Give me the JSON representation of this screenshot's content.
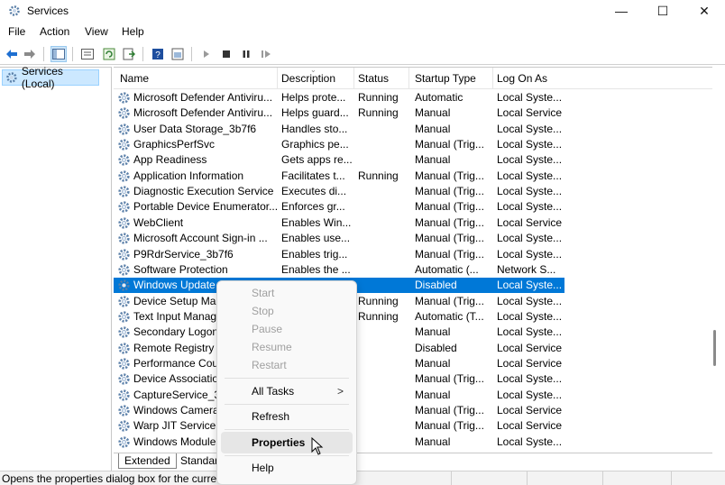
{
  "window": {
    "title": "Services",
    "min": "—",
    "max": "☐",
    "close": "✕"
  },
  "menu": [
    "File",
    "Action",
    "View",
    "Help"
  ],
  "tree": {
    "root": "Services (Local)"
  },
  "columns": {
    "name": "Name",
    "description": "Description",
    "status": "Status",
    "startup": "Startup Type",
    "logon": "Log On As"
  },
  "rows": [
    {
      "name": "Microsoft Defender Antiviru...",
      "desc": "Helps prote...",
      "status": "Running",
      "startup": "Automatic",
      "logon": "Local Syste..."
    },
    {
      "name": "Microsoft Defender Antiviru...",
      "desc": "Helps guard...",
      "status": "Running",
      "startup": "Manual",
      "logon": "Local Service"
    },
    {
      "name": "User Data Storage_3b7f6",
      "desc": "Handles sto...",
      "status": "",
      "startup": "Manual",
      "logon": "Local Syste..."
    },
    {
      "name": "GraphicsPerfSvc",
      "desc": "Graphics pe...",
      "status": "",
      "startup": "Manual (Trig...",
      "logon": "Local Syste..."
    },
    {
      "name": "App Readiness",
      "desc": "Gets apps re...",
      "status": "",
      "startup": "Manual",
      "logon": "Local Syste..."
    },
    {
      "name": "Application Information",
      "desc": "Facilitates t...",
      "status": "Running",
      "startup": "Manual (Trig...",
      "logon": "Local Syste..."
    },
    {
      "name": "Diagnostic Execution Service",
      "desc": "Executes di...",
      "status": "",
      "startup": "Manual (Trig...",
      "logon": "Local Syste..."
    },
    {
      "name": "Portable Device Enumerator...",
      "desc": "Enforces gr...",
      "status": "",
      "startup": "Manual (Trig...",
      "logon": "Local Syste..."
    },
    {
      "name": "WebClient",
      "desc": "Enables Win...",
      "status": "",
      "startup": "Manual (Trig...",
      "logon": "Local Service"
    },
    {
      "name": "Microsoft Account Sign-in ...",
      "desc": "Enables use...",
      "status": "",
      "startup": "Manual (Trig...",
      "logon": "Local Syste..."
    },
    {
      "name": "P9RdrService_3b7f6",
      "desc": "Enables trig...",
      "status": "",
      "startup": "Manual (Trig...",
      "logon": "Local Syste..."
    },
    {
      "name": "Software Protection",
      "desc": "Enables the ...",
      "status": "",
      "startup": "Automatic (...",
      "logon": "Network S..."
    },
    {
      "name": "Windows Update",
      "desc": "",
      "status": "",
      "startup": "Disabled",
      "logon": "Local Syste...",
      "selected": true
    },
    {
      "name": "Device Setup Mar",
      "desc": "",
      "status": "Running",
      "startup": "Manual (Trig...",
      "logon": "Local Syste..."
    },
    {
      "name": "Text Input Manag",
      "desc": "",
      "status": "Running",
      "startup": "Automatic (T...",
      "logon": "Local Syste..."
    },
    {
      "name": "Secondary Logon",
      "desc": "",
      "status": "",
      "startup": "Manual",
      "logon": "Local Syste..."
    },
    {
      "name": "Remote Registry",
      "desc": "",
      "status": "",
      "startup": "Disabled",
      "logon": "Local Service"
    },
    {
      "name": "Performance Cou",
      "desc": "",
      "status": "",
      "startup": "Manual",
      "logon": "Local Service"
    },
    {
      "name": "Device Associatio",
      "desc": "",
      "status": "",
      "startup": "Manual (Trig...",
      "logon": "Local Syste..."
    },
    {
      "name": "CaptureService_3l",
      "desc": "",
      "status": "",
      "startup": "Manual",
      "logon": "Local Syste..."
    },
    {
      "name": "Windows Camera",
      "desc": "",
      "status": "",
      "startup": "Manual (Trig...",
      "logon": "Local Service"
    },
    {
      "name": "Warp JIT Service",
      "desc": "",
      "status": "",
      "startup": "Manual (Trig...",
      "logon": "Local Service"
    },
    {
      "name": "Windows Module",
      "desc": "",
      "status": "",
      "startup": "Manual",
      "logon": "Local Syste..."
    }
  ],
  "tabs": {
    "extended": "Extended",
    "standard": "Standar"
  },
  "status_bar": {
    "text": "Opens the properties dialog box for the current selection."
  },
  "context_menu": {
    "start": "Start",
    "stop": "Stop",
    "pause": "Pause",
    "resume": "Resume",
    "restart": "Restart",
    "all_tasks": "All Tasks",
    "all_tasks_arrow": ">",
    "refresh": "Refresh",
    "properties": "Properties",
    "help": "Help"
  },
  "colors": {
    "selection": "#0078d7",
    "accent_blue": "#1e6fd1",
    "disabled_text": "#a0a0a0"
  },
  "icons": [
    "services-app-icon",
    "back-arrow-icon",
    "forward-arrow-icon",
    "show-hide-tree-icon",
    "properties-icon",
    "refresh-icon",
    "export-list-icon",
    "help-icon",
    "view-icon",
    "play-icon",
    "stop-icon",
    "pause-icon",
    "restart-icon",
    "gear-icon",
    "mouse-cursor-icon"
  ]
}
